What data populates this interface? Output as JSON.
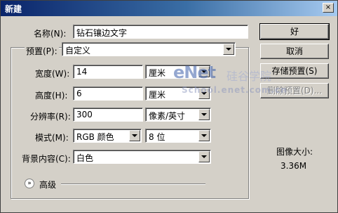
{
  "title": "新建",
  "close_label": "×",
  "name": {
    "label": "名称(N):",
    "value": "钻石镶边文字"
  },
  "preset": {
    "label": "预置(P):",
    "value": "自定义"
  },
  "width": {
    "label": "宽度(W):",
    "value": "14",
    "unit": "厘米"
  },
  "height": {
    "label": "高度(H):",
    "value": "6",
    "unit": "厘米"
  },
  "resolution": {
    "label": "分辨率(R):",
    "value": "300",
    "unit": "像素/英寸"
  },
  "mode": {
    "label": "模式(M):",
    "value": "RGB 颜色",
    "depth": "8 位"
  },
  "background": {
    "label": "背景内容(C):",
    "value": "白色"
  },
  "advanced": {
    "label": "高级",
    "icon": "double-chevron-down-icon"
  },
  "buttons": {
    "ok": "好",
    "cancel": "取消",
    "save_preset": "存储预置(S)",
    "delete_preset": "删除预置(D)..."
  },
  "image_size": {
    "label": "图像大小:",
    "value": "3.36M"
  },
  "watermark": {
    "main": "eNet",
    "cn": "硅谷学院",
    "url": "School.enet.com.cn"
  }
}
